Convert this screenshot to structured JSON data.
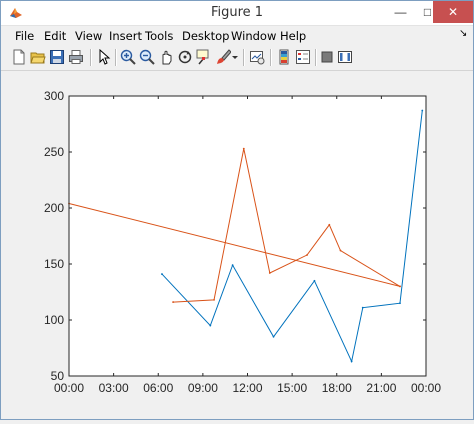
{
  "window": {
    "title": "Figure 1",
    "minimize": "—",
    "maximize": "□",
    "close": "✕"
  },
  "menu": [
    "File",
    "Edit",
    "View",
    "Insert",
    "Tools",
    "Desktop",
    "Window",
    "Help"
  ],
  "dock_glyph": "↘",
  "toolbar_icons": [
    "new-figure-icon",
    "open-file-icon",
    "save-icon",
    "print-icon",
    "pointer-icon",
    "zoom-in-icon",
    "zoom-out-icon",
    "pan-icon",
    "rotate-3d-icon",
    "data-cursor-icon",
    "brush-icon",
    "brush-dropdown-icon",
    "link-plot-icon",
    "colorbar-icon",
    "legend-icon",
    "hide-plot-tools-icon",
    "show-plot-tools-icon"
  ],
  "colors": {
    "series_1": "#0072bd",
    "series_2": "#d95319"
  },
  "chart_data": {
    "type": "line",
    "title": "",
    "xlabel": "",
    "ylabel": "",
    "xlim": [
      "00:00",
      "00:00"
    ],
    "ylim": [
      50,
      300
    ],
    "x_ticks": [
      "00:00",
      "03:00",
      "06:00",
      "09:00",
      "12:00",
      "15:00",
      "18:00",
      "21:00",
      "00:00"
    ],
    "y_ticks": [
      50,
      100,
      150,
      200,
      250,
      300
    ],
    "grid": false,
    "legend": "none",
    "series": [
      {
        "color": "#0072bd",
        "x": [
          "06:15",
          "09:30",
          "11:00",
          "13:45",
          "16:30",
          "19:00",
          "19:45",
          "22:15",
          "23:45"
        ],
        "y": [
          141,
          95,
          149,
          85,
          135,
          63,
          111,
          115,
          287
        ]
      },
      {
        "color": "#d95319",
        "x": [
          "07:00",
          "09:45",
          "11:45",
          "13:30",
          "16:00",
          "17:30",
          "18:15",
          "22:15"
        ],
        "y": [
          116,
          118,
          253,
          142,
          158,
          185,
          162,
          130
        ]
      },
      {
        "color": "#d95319",
        "x": [
          "00:00",
          "22:15"
        ],
        "y": [
          204,
          130
        ]
      }
    ]
  }
}
